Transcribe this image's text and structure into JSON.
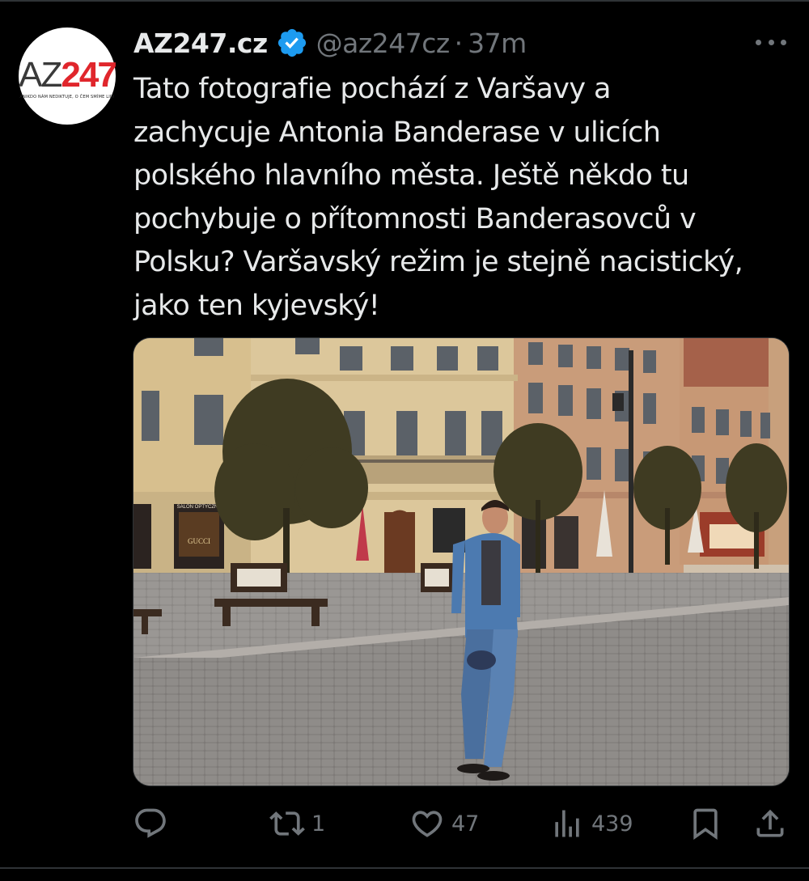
{
  "author": {
    "display_name": "AZ247.cz",
    "handle": "@az247cz",
    "separator": "·",
    "time": "37m",
    "verified": true,
    "avatar": {
      "logo_left": "AZ",
      "logo_right": "247",
      "tagline": "ANIKDO NÁM NEDIKTUJE, O ČEM SMÍME LIDI"
    }
  },
  "more_icon": "more-horizontal-icon",
  "tweet": {
    "text": "Tato fotografie pochází z Varšavy a\nzachycuje Antonia Banderase v ulicích\npolského hlavního města. Ještě někdo tu\npochybuje o přítomnosti Banderasovců v\nPolsku? Varšavský režim je stejně nacistický,\njako ten kyjevský!"
  },
  "media": {
    "shop_sign_left": "SALON OPTYCZNY",
    "shop_brand": "GUCCI"
  },
  "actions": {
    "reply": {
      "icon": "reply-icon",
      "count": ""
    },
    "retweet": {
      "icon": "retweet-icon",
      "count": "1"
    },
    "like": {
      "icon": "heart-icon",
      "count": "47"
    },
    "views": {
      "icon": "views-icon",
      "count": "439"
    },
    "bookmark": {
      "icon": "bookmark-icon",
      "count": ""
    },
    "share": {
      "icon": "share-icon",
      "count": ""
    }
  },
  "colors": {
    "background": "#000000",
    "text": "#e7e9ea",
    "secondary": "#71767b",
    "verified": "#1d9bf0",
    "brand_red": "#e0262c"
  }
}
